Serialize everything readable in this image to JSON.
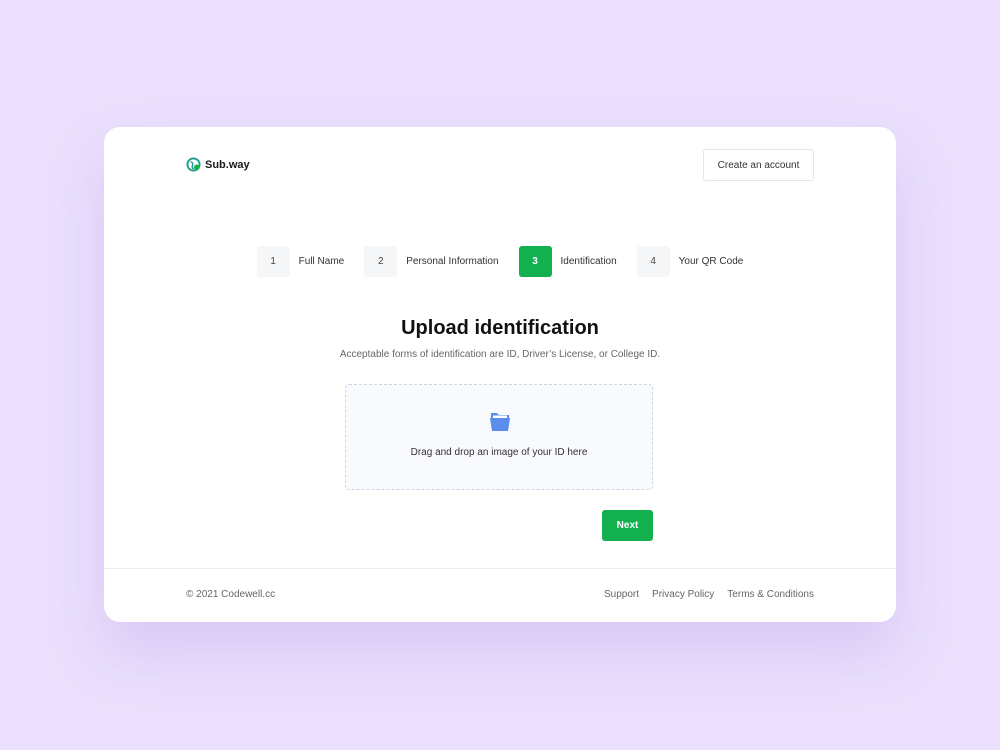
{
  "brand": {
    "name": "Sub.way",
    "accent": "#12b04f",
    "logo_color": "#1f9e8a"
  },
  "header": {
    "create_account_label": "Create an account"
  },
  "steps": [
    {
      "number": "1",
      "label": "Full Name",
      "active": false
    },
    {
      "number": "2",
      "label": "Personal Information",
      "active": false
    },
    {
      "number": "3",
      "label": "Identification",
      "active": true
    },
    {
      "number": "4",
      "label": "Your QR Code",
      "active": false
    }
  ],
  "main": {
    "title": "Upload identification",
    "subtitle": "Acceptable forms of identification are ID, Driver’s License, or College ID.",
    "dropzone": {
      "icon": "open-folder-icon",
      "text": "Drag and drop an image of your ID here"
    },
    "next_label": "Next"
  },
  "footer": {
    "copyright": "© 2021 Codewell.cc",
    "links": [
      "Support",
      "Privacy Policy",
      "Terms & Conditions"
    ]
  }
}
